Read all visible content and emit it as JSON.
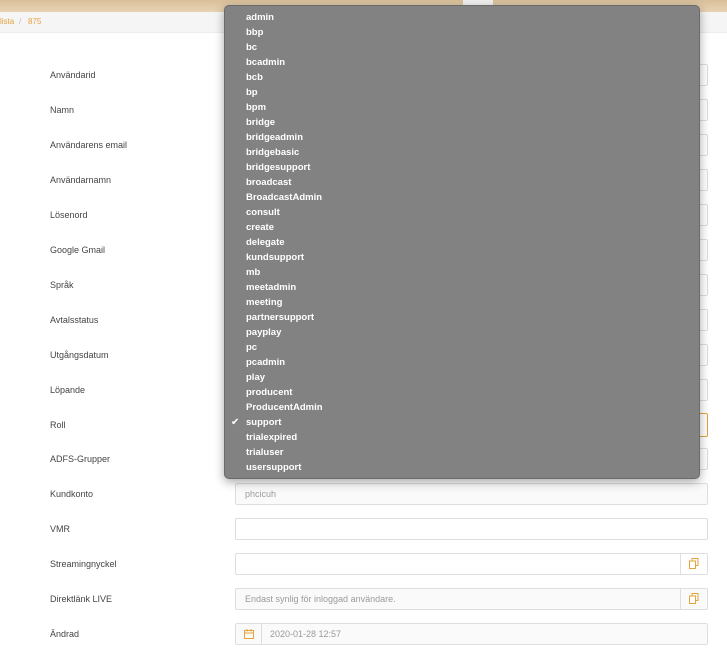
{
  "breadcrumb": {
    "items": [
      "lista",
      "875"
    ],
    "separator": "/"
  },
  "form": {
    "labels": {
      "user_id": "Användarid",
      "name": "Namn",
      "email": "Användarens email",
      "username": "Användarnamn",
      "password": "Lösenord",
      "google_gmail": "Google Gmail",
      "language": "Språk",
      "contract_status": "Avtalsstatus",
      "expiry_date": "Utgångsdatum",
      "running": "Löpande",
      "role": "Roll",
      "adfs_groups": "ADFS-Grupper",
      "customer_account": "Kundkonto",
      "vmr": "VMR",
      "streaming_key": "Streamingnyckel",
      "direct_link_live": "Direktlänk LIVE",
      "changed": "Ändrad"
    },
    "values": {
      "customer_account": "phcicuh",
      "vmr": "",
      "streaming_key": "",
      "direct_link_live": "Endast synlig för inloggad användare.",
      "changed": "2020-01-28 12:57"
    }
  },
  "role_dropdown": {
    "options": [
      "admin",
      "bbp",
      "bc",
      "bcadmin",
      "bcb",
      "bp",
      "bpm",
      "bridge",
      "bridgeadmin",
      "bridgebasic",
      "bridgesupport",
      "broadcast",
      "BroadcastAdmin",
      "consult",
      "create",
      "delegate",
      "kundsupport",
      "mb",
      "meetadmin",
      "meeting",
      "partnersupport",
      "payplay",
      "pc",
      "pcadmin",
      "play",
      "producent",
      "ProducentAdmin",
      "support",
      "trialexpired",
      "trialuser",
      "usersupport"
    ],
    "selected": "support",
    "check_glyph": "✔"
  },
  "colors": {
    "accent": "#e6a23c",
    "dropdown_bg": "#828282"
  },
  "icons": {
    "copy": "copy-icon",
    "calendar": "calendar-icon",
    "check": "checkmark-icon"
  }
}
